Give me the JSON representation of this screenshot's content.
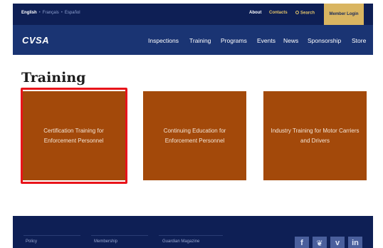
{
  "topbar": {
    "languages": [
      "English",
      "Français",
      "Español"
    ],
    "separator": "•",
    "about": "About",
    "contacts": "Contacts",
    "search": "Search",
    "member_login": "Member Login"
  },
  "nav": {
    "logo": "CVSA",
    "items": [
      "Inspections",
      "Training",
      "Programs",
      "Events",
      "News",
      "Sponsorship",
      "Store"
    ]
  },
  "page": {
    "title": "Training"
  },
  "cards": [
    {
      "label": "Certification Training for Enforcement Personnel",
      "highlighted": true
    },
    {
      "label": "Continuing Education for Enforcement Personnel",
      "highlighted": false
    },
    {
      "label": "Industry Training for Motor Carriers and Drivers",
      "highlighted": false
    }
  ],
  "footer": {
    "links": [
      "Policy",
      "Membership",
      "Guardian Magazine"
    ],
    "social": [
      {
        "icon": "facebook-icon",
        "glyph": "f"
      },
      {
        "icon": "twitter-icon",
        "glyph": "❦"
      },
      {
        "icon": "vimeo-icon",
        "glyph": "v"
      },
      {
        "icon": "linkedin-icon",
        "glyph": "in"
      }
    ]
  },
  "colors": {
    "topbar": "#0e1f55",
    "navbar": "#1a3473",
    "accent_gold": "#d9b561",
    "card": "#a3490a",
    "highlight": "#e8141a"
  }
}
